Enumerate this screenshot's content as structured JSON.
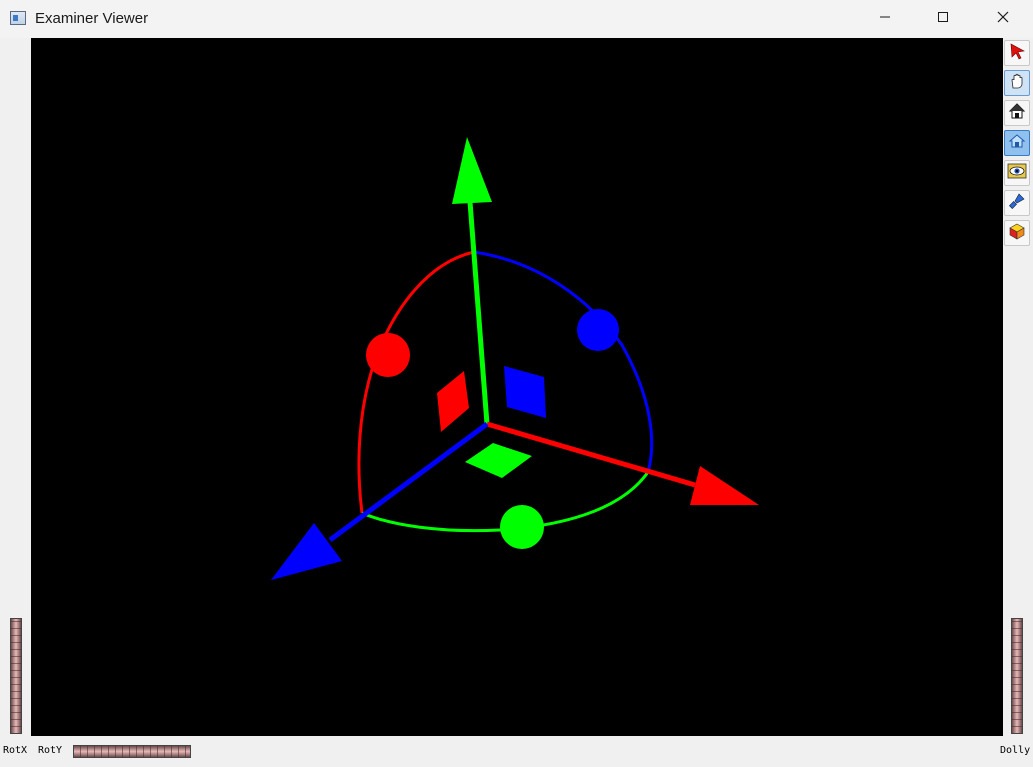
{
  "window": {
    "title": "Examiner Viewer"
  },
  "title_controls": [
    "minimize-icon",
    "maximize-icon",
    "close-icon"
  ],
  "toolbar": [
    {
      "name": "select-arrow-button",
      "icon": "red-arrow-pointer-icon",
      "active": false
    },
    {
      "name": "view-hand-button",
      "icon": "hand-icon",
      "active": true
    },
    {
      "name": "home-button",
      "icon": "house-icon",
      "active": false
    },
    {
      "name": "set-home-button",
      "icon": "blue-house-icon",
      "active": false
    },
    {
      "name": "view-all-button",
      "icon": "eye-icon",
      "active": false
    },
    {
      "name": "seek-button",
      "icon": "flashlight-icon",
      "active": false
    },
    {
      "name": "projection-button",
      "icon": "cube-icon",
      "active": false
    }
  ],
  "wheels": {
    "rotx_label": "RotX",
    "roty_label": "RotY",
    "dolly_label": "Dolly"
  },
  "colors": {
    "x_axis": "#ff0000",
    "y_axis": "#00ff00",
    "z_axis": "#0000ff",
    "viewport_bg": "#000000"
  }
}
